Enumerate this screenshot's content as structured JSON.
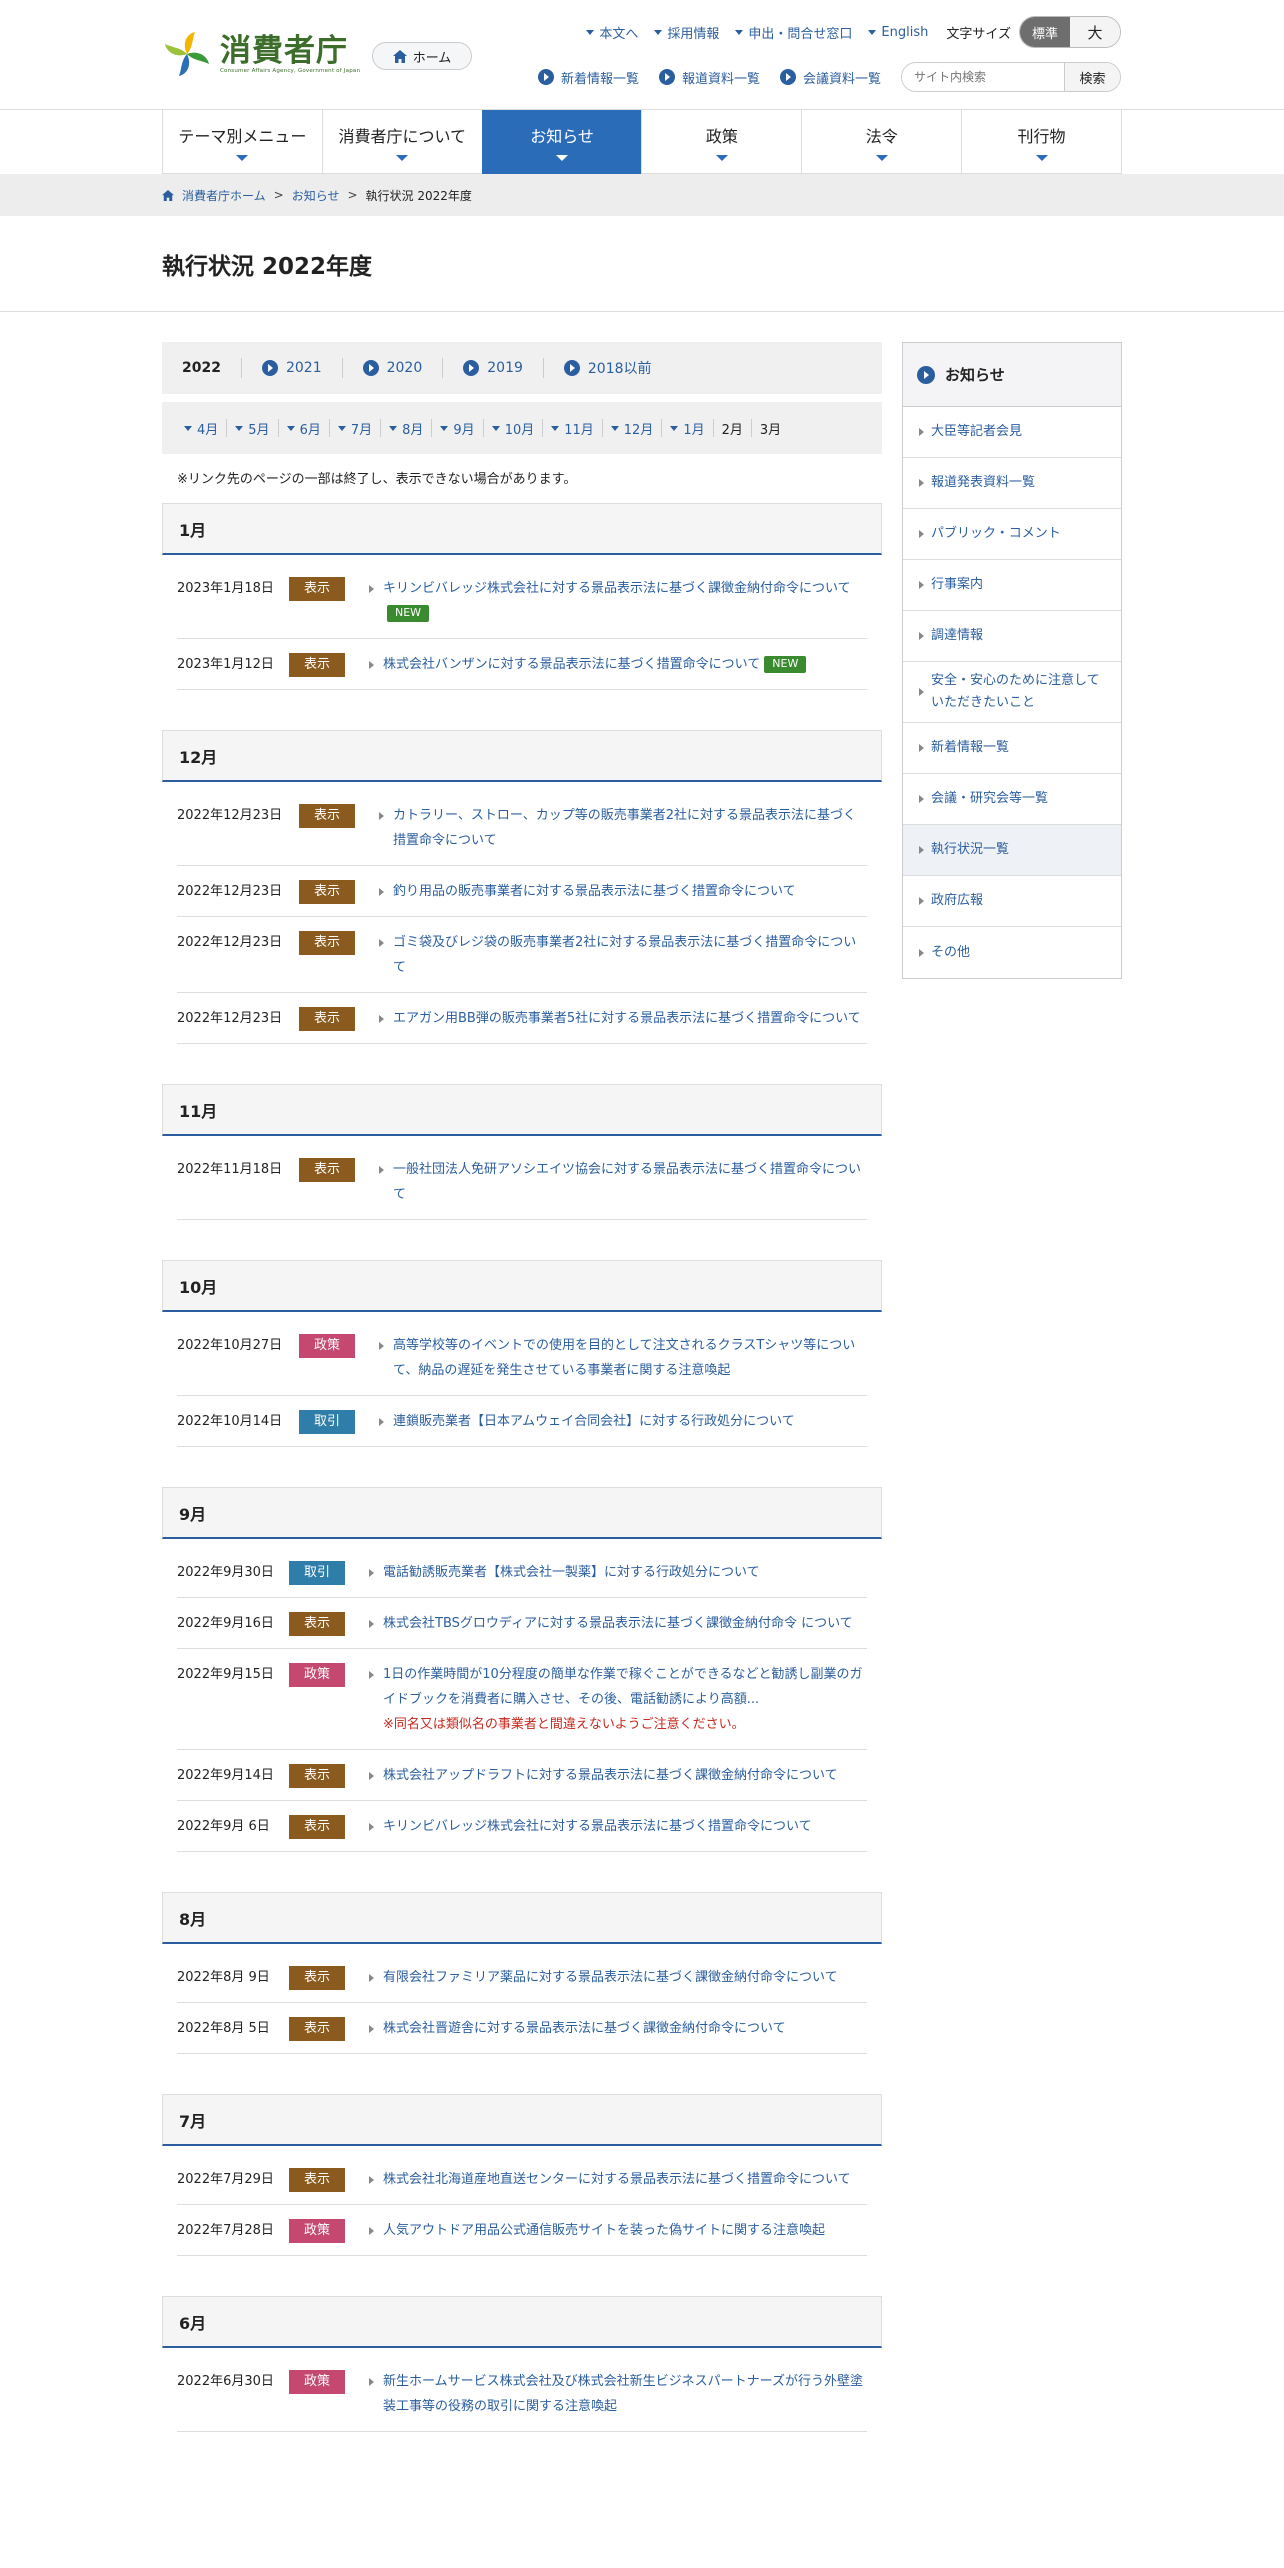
{
  "logo": {
    "title": "消費者庁",
    "subtitle": "Consumer Affairs Agency, Government of Japan"
  },
  "header": {
    "home": "ホーム",
    "util_links": [
      "本文へ",
      "採用情報",
      "申出・問合せ窓口",
      "English"
    ],
    "font_size_label": "文字サイズ",
    "font_std": "標準",
    "font_big": "大",
    "util2_links": [
      "新着情報一覧",
      "報道資料一覧",
      "会議資料一覧"
    ],
    "search_placeholder": "サイト内検索",
    "search_button": "検索"
  },
  "gnav": [
    "テーマ別メニュー",
    "消費者庁について",
    "お知らせ",
    "政策",
    "法令",
    "刊行物"
  ],
  "breadcrumb": [
    "消費者庁ホーム",
    "お知らせ",
    "執行状況 2022年度"
  ],
  "page_title": "執行状況 2022年度",
  "years": {
    "current": "2022",
    "links": [
      "2021",
      "2020",
      "2019",
      "2018以前"
    ]
  },
  "months": {
    "links": [
      "4月",
      "5月",
      "6月",
      "7月",
      "8月",
      "9月",
      "10月",
      "11月",
      "12月",
      "1月"
    ],
    "plain": [
      "2月",
      "3月"
    ]
  },
  "note": "※リンク先のページの一部は終了し、表示できない場合があります。",
  "sections": [
    {
      "month": "1月",
      "rows": [
        {
          "date": "2023年1月18日",
          "badge": "表示",
          "type": "hyoji",
          "text": "キリンビバレッジ株式会社に対する景品表示法に基づく課徴金納付命令について",
          "new": "NEW"
        },
        {
          "date": "2023年1月12日",
          "badge": "表示",
          "type": "hyoji",
          "text": "株式会社バンザンに対する景品表示法に基づく措置命令について",
          "new": "NEW"
        }
      ]
    },
    {
      "month": "12月",
      "rows": [
        {
          "date": "2022年12月23日",
          "badge": "表示",
          "type": "hyoji",
          "text": "カトラリー、ストロー、カップ等の販売事業者2社に対する景品表示法に基づく措置命令について"
        },
        {
          "date": "2022年12月23日",
          "badge": "表示",
          "type": "hyoji",
          "text": "釣り用品の販売事業者に対する景品表示法に基づく措置命令について"
        },
        {
          "date": "2022年12月23日",
          "badge": "表示",
          "type": "hyoji",
          "text": "ゴミ袋及びレジ袋の販売事業者2社に対する景品表示法に基づく措置命令について"
        },
        {
          "date": "2022年12月23日",
          "badge": "表示",
          "type": "hyoji",
          "text": "エアガン用BB弾の販売事業者5社に対する景品表示法に基づく措置命令について"
        }
      ]
    },
    {
      "month": "11月",
      "rows": [
        {
          "date": "2022年11月18日",
          "badge": "表示",
          "type": "hyoji",
          "text": "一般社団法人免研アソシエイツ協会に対する景品表示法に基づく措置命令について"
        }
      ]
    },
    {
      "month": "10月",
      "rows": [
        {
          "date": "2022年10月27日",
          "badge": "政策",
          "type": "seisaku",
          "text": "高等学校等のイベントでの使用を目的として注文されるクラスTシャツ等について、納品の遅延を発生させている事業者に関する注意喚起"
        },
        {
          "date": "2022年10月14日",
          "badge": "取引",
          "type": "torihiki",
          "text": "連鎖販売業者【日本アムウェイ合同会社】に対する行政処分について"
        }
      ]
    },
    {
      "month": "9月",
      "rows": [
        {
          "date": "2022年9月30日",
          "badge": "取引",
          "type": "torihiki",
          "text": "電話勧誘販売業者【株式会社一製薬】に対する行政処分について"
        },
        {
          "date": "2022年9月16日",
          "badge": "表示",
          "type": "hyoji",
          "text": "株式会社TBSグロウディアに対する景品表示法に基づく課徴金納付命令 について"
        },
        {
          "date": "2022年9月15日",
          "badge": "政策",
          "type": "seisaku",
          "text": "1日の作業時間が10分程度の簡単な作業で稼ぐことができるなどと勧誘し副業のガイドブックを消費者に購入させ、その後、電話勧誘により高額...",
          "warn": "※同名又は類似名の事業者と間違えないようご注意ください。"
        },
        {
          "date": "2022年9月14日",
          "badge": "表示",
          "type": "hyoji",
          "text": "株式会社アップドラフトに対する景品表示法に基づく課徴金納付命令について"
        },
        {
          "date": "2022年9月 6日",
          "badge": "表示",
          "type": "hyoji",
          "text": "キリンビバレッジ株式会社に対する景品表示法に基づく措置命令について"
        }
      ]
    },
    {
      "month": "8月",
      "rows": [
        {
          "date": "2022年8月 9日",
          "badge": "表示",
          "type": "hyoji",
          "text": "有限会社ファミリア薬品に対する景品表示法に基づく課徴金納付命令について"
        },
        {
          "date": "2022年8月 5日",
          "badge": "表示",
          "type": "hyoji",
          "text": "株式会社晋遊舎に対する景品表示法に基づく課徴金納付命令について"
        }
      ]
    },
    {
      "month": "7月",
      "rows": [
        {
          "date": "2022年7月29日",
          "badge": "表示",
          "type": "hyoji",
          "text": "株式会社北海道産地直送センターに対する景品表示法に基づく措置命令について"
        },
        {
          "date": "2022年7月28日",
          "badge": "政策",
          "type": "seisaku",
          "text": "人気アウトドア用品公式通信販売サイトを装った偽サイトに関する注意喚起"
        }
      ]
    },
    {
      "month": "6月",
      "rows": [
        {
          "date": "2022年6月30日",
          "badge": "政策",
          "type": "seisaku",
          "text": "新生ホームサービス株式会社及び株式会社新生ビジネスパートナーズが行う外壁塗装工事等の役務の取引に関する注意喚起"
        }
      ]
    }
  ],
  "sidebar": {
    "title": "お知らせ",
    "items": [
      "大臣等記者会見",
      "報道発表資料一覧",
      "パブリック・コメント",
      "行事案内",
      "調達情報",
      "安全・安心のために注意していただきたいこと",
      "新着情報一覧",
      "会議・研究会等一覧",
      "執行状況一覧",
      "政府広報",
      "その他"
    ],
    "current": "執行状況一覧"
  },
  "colors": {
    "accent": "#2b6cb8",
    "link": "#2b5e9e",
    "badge_hyoji": "#8a5a1e",
    "badge_seisaku": "#c4486f",
    "badge_torihiki": "#2f7da9",
    "new": "#3a8a2f",
    "warn": "#c8281e"
  }
}
